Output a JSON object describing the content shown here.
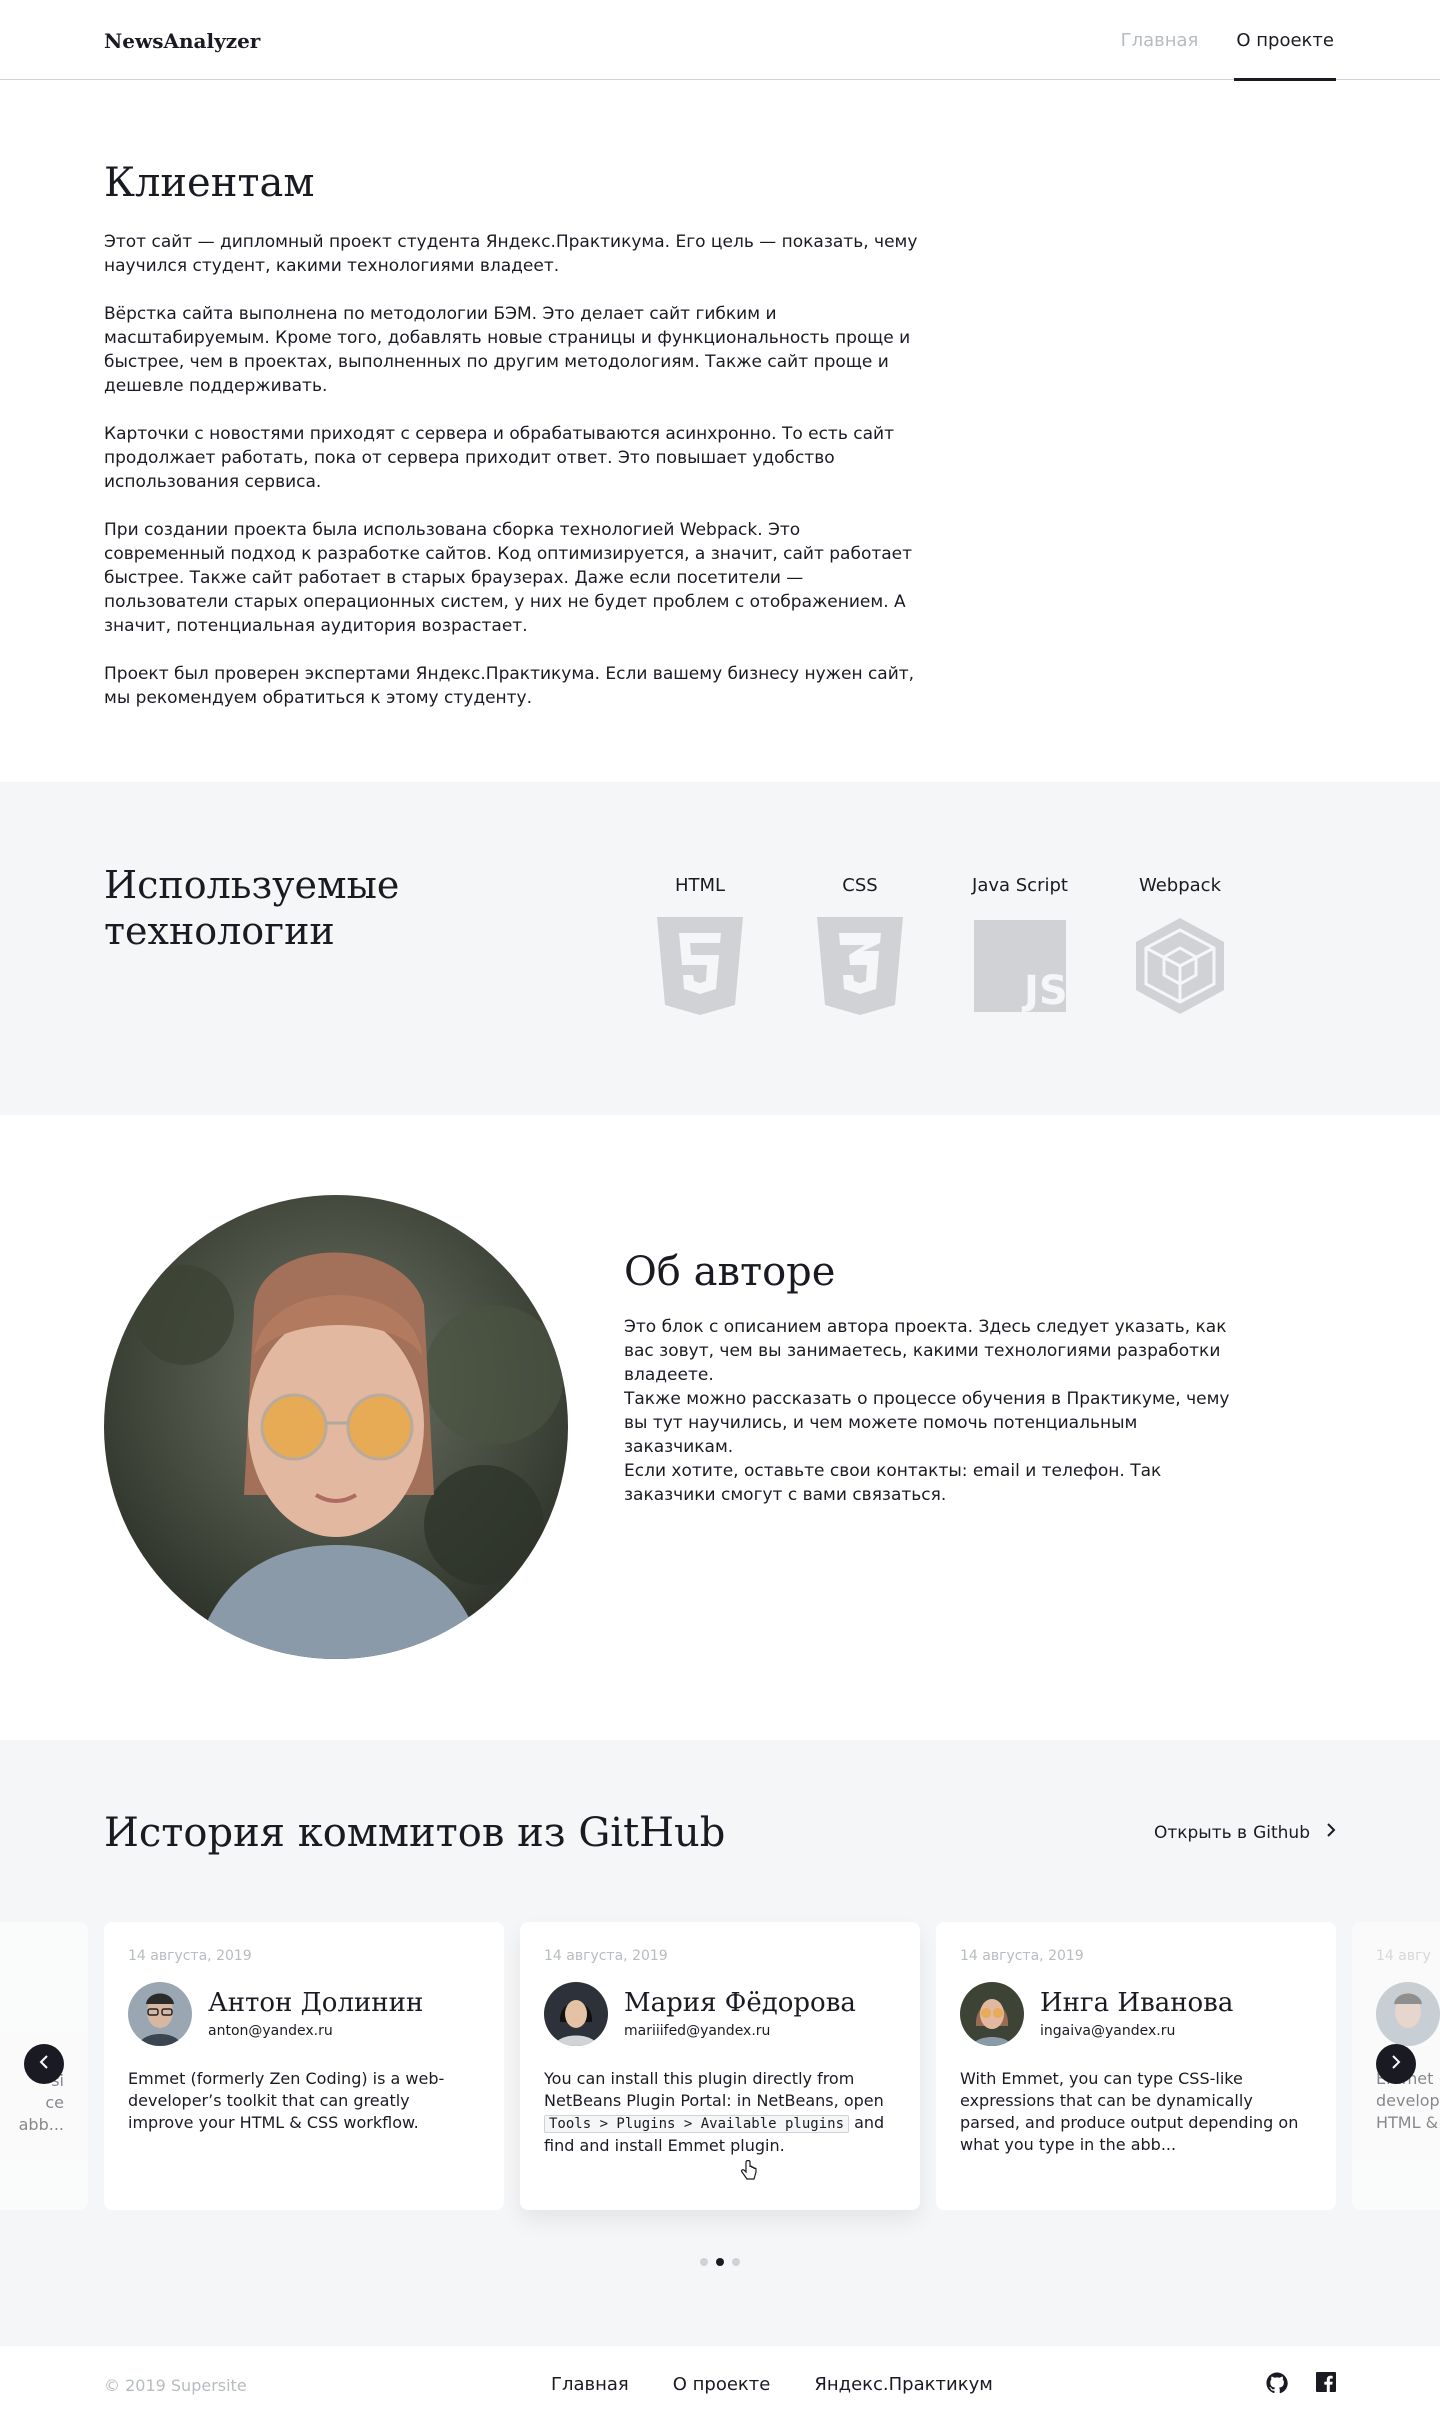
{
  "header": {
    "logo": "NewsAnalyzer",
    "nav": [
      {
        "label": "Главная",
        "active": false
      },
      {
        "label": "О проекте",
        "active": true
      }
    ]
  },
  "clients": {
    "title": "Клиентам",
    "paragraphs": [
      "Этот сайт — дипломный проект студента Яндекс.Практикума. Его цель — показать, чему научился студент, какими технологиями владеет.",
      "Вёрстка сайта выполнена по методологии БЭМ. Это делает сайт гибким и масштабируемым. Кроме того, добавлять новые страницы и функциональность проще и быстрее, чем в проектах, выполненных по другим методологиям. Также сайт проще и дешевле поддерживать.",
      "Карточки с новостями приходят с сервера и обрабатываются асинхронно. То есть сайт продолжает работать, пока от сервера приходит ответ. Это повышает удобство использования сервиса.",
      "При создании проекта была использована сборка технологией Webpack. Это современный подход к разработке сайтов. Код оптимизируется, а значит, сайт работает быстрее. Также сайт работает в старых браузерах. Даже если посетители — пользователи старых операционных систем, у них не будет проблем с отображением. А значит, потенциальная аудитория возрастает.",
      "Проект был проверен экспертами Яндекс.Практикума. Если вашему бизнесу нужен сайт, мы рекомендуем обратиться к этому студенту."
    ]
  },
  "technologies": {
    "title": "Используемые технологии",
    "items": [
      {
        "label": "HTML",
        "icon": "html5-icon"
      },
      {
        "label": "CSS",
        "icon": "css3-icon"
      },
      {
        "label": "Java Script",
        "icon": "javascript-icon"
      },
      {
        "label": "Webpack",
        "icon": "webpack-icon"
      }
    ]
  },
  "author": {
    "title": "Об авторе",
    "description": [
      "Это блок с описанием автора проекта. Здесь следует указать, как вас зовут, чем вы занимаетесь, какими технологиями разработки владеете.",
      "Также можно рассказать о процессе обучения в Практикуме, чему вы тут научились, и чем можете помочь потенциальным заказчикам.",
      "Если хотите, оставьте свои контакты: email и телефон. Так заказчики смогут с вами связаться."
    ]
  },
  "github": {
    "title": "История коммитов из GitHub",
    "link_prefix": "Открыть в",
    "link_label": "Github",
    "cards": [
      {
        "date": "14 августа, 2019",
        "name": "Антон Долинин",
        "email": "anton@yandex.ru",
        "text": "Emmet (formerly Zen Coding) is a web-developer’s toolkit that can greatly improve your HTML & CSS workflow."
      },
      {
        "date": "14 августа, 2019",
        "name": "Мария Фёдорова",
        "email": "mariiifed@yandex.ru",
        "text_before": "You can install this plugin directly from NetBeans Plugin Portal: in NetBeans, open",
        "code": "Tools > Plugins > Available plugins",
        "text_after": "and find and install Emmet plugin."
      },
      {
        "date": "14 августа, 2019",
        "name": "Инга Иванова",
        "email": "ingaiva@yandex.ru",
        "text": "With Emmet, you can type CSS-like expressions that can be dynamically parsed, and produce output depending on what you type in the abb..."
      }
    ],
    "partial_left": {
      "lines": [
        "si",
        "ce",
        "abb..."
      ]
    },
    "partial_right": {
      "date": "14 авгу",
      "lines": [
        "Emmet (",
        "develop",
        "HTML &"
      ]
    },
    "dots": [
      false,
      true,
      false
    ]
  },
  "footer": {
    "copyright": "© 2019  Supersite",
    "nav": [
      "Главная",
      "О проекте",
      "Яндекс.Практикум"
    ],
    "social": [
      "github-icon",
      "facebook-icon"
    ]
  },
  "colors": {
    "text": "#1a1b22",
    "muted": "#b6bcbf",
    "gray_bg": "#f5f6f7",
    "icon_gray": "#d1d2d6"
  }
}
